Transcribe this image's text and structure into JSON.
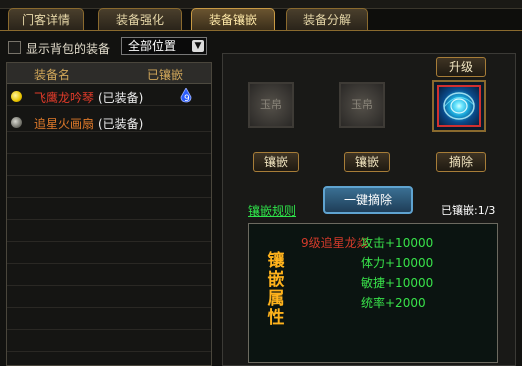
{
  "tabs": [
    {
      "label": "门客详情",
      "active": false
    },
    {
      "label": "装备强化",
      "active": false
    },
    {
      "label": "装备镶嵌",
      "active": true
    },
    {
      "label": "装备分解",
      "active": false
    }
  ],
  "filter": {
    "show_bag_label": "显示背包的装备",
    "show_bag_checked": false,
    "position_select": "全部位置"
  },
  "list": {
    "col_name": "装备名",
    "col_inlaid": "已镶嵌",
    "rows": [
      {
        "name": "飞鹰龙吟琴",
        "status": "(已装备)",
        "selected": true,
        "gem_count": "9",
        "name_color": "#e03a2a"
      },
      {
        "name": "追星火画扇",
        "status": "(已装备)",
        "selected": false,
        "gem_count": "",
        "name_color": "#e07a2a"
      }
    ]
  },
  "slots": {
    "slot1_text": "玉帛",
    "slot2_text": "玉帛",
    "inlay_btn1": "镶嵌",
    "inlay_btn2": "镶嵌",
    "upgrade_btn": "升级",
    "remove_btn": "摘除"
  },
  "actions": {
    "rules_link": "镶嵌规则",
    "one_key_remove": "一键摘除",
    "inlaid_count": "已镶嵌:1/3"
  },
  "attributes": {
    "title": "镶嵌属性",
    "gem_name": "9级追星龙焱",
    "lines": [
      "攻击+10000",
      "体力+10000",
      "敏捷+10000",
      "统率+2000"
    ]
  },
  "colors": {
    "accent_gold": "#c89a44",
    "attr_green": "#38e24a",
    "gem_red": "#d23a2a",
    "title_orange": "#ffb21c"
  }
}
